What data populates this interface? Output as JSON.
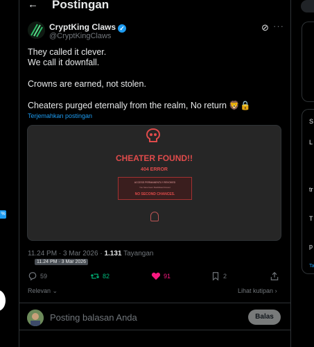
{
  "header": {
    "title": "Postingan",
    "back_icon": "arrow-left-icon"
  },
  "post": {
    "author_name": "CryptKing Claws",
    "author_handle": "@CryptKingClaws",
    "lines": [
      "They called it clever.",
      "We call it downfall.",
      "Crowns are earned, not stolen.",
      "Cheaters purged eternally from the realm, No return 🦁🔒"
    ],
    "translate_label": "Terjemahkan postingan",
    "media": {
      "headline": "CHEATER FOUND!!",
      "error": "404 ERROR",
      "box_title": "ACCESS PERMANENTLY REVOKED",
      "box_sub": "You have been blacklisted forever",
      "box_footer": "NO SECOND CHANCES."
    },
    "time": "11.24 PM · 3 Mar 2026",
    "views_count": "1.131",
    "views_label": "Tayangan",
    "tooltip": "11.24 PM · 3 Mar 2026"
  },
  "actions": {
    "reply": "59",
    "repost": "82",
    "like": "91",
    "bookmark": "2"
  },
  "sort": {
    "relevan": "Relevan",
    "quotes": "Lihat kutipan"
  },
  "reply_box": {
    "placeholder": "Posting balasan Anda",
    "button": "Balas"
  },
  "colors": {
    "accent": "#1d9bf0",
    "repost": "#00ba7c",
    "like": "#f91880",
    "error_red": "#e04b4b"
  },
  "left_badge": "%",
  "right_sidebar": {
    "heading": "S",
    "items": [
      "L",
      "tr",
      "T",
      "p",
      "Ta"
    ]
  }
}
